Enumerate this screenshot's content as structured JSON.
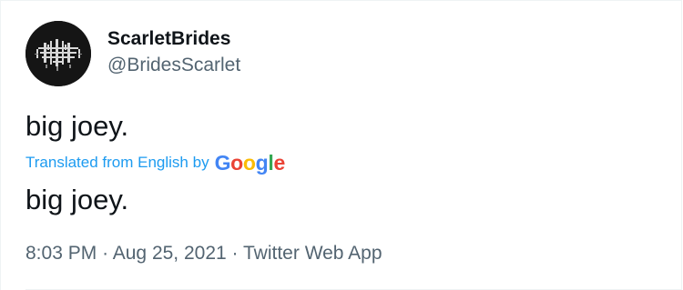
{
  "author": {
    "display_name": "ScarletBrides",
    "handle": "@BridesScarlet",
    "avatar_icon": "band-logo-avatar-icon"
  },
  "tweet": {
    "text": "big joey.",
    "translated_text": "big joey."
  },
  "translation": {
    "label": "Translated from English by",
    "provider": {
      "letters": [
        "G",
        "o",
        "o",
        "g",
        "l",
        "e"
      ],
      "colors": [
        "#4285f4",
        "#ea4335",
        "#fbbc05",
        "#4285f4",
        "#34a853",
        "#ea4335"
      ]
    }
  },
  "meta": {
    "time": "8:03 PM",
    "date": "Aug 25, 2021",
    "source": "Twitter Web App",
    "separator": "·"
  },
  "colors": {
    "text_primary": "#0f1419",
    "text_secondary": "#536471",
    "link": "#1d9bf0",
    "border": "#eff3f4"
  }
}
